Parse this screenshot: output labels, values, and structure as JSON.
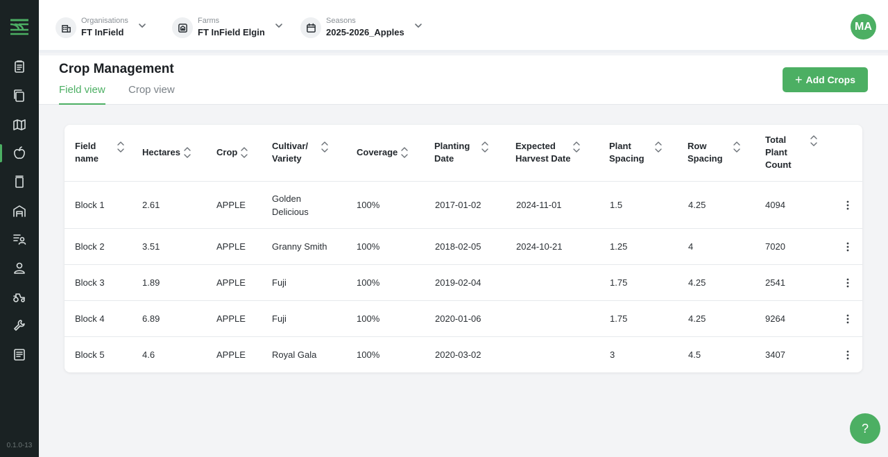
{
  "app": {
    "version": "0.1.0-13",
    "accent_color": "#4caf63",
    "sidebar_color": "#1a2223"
  },
  "sidebar": {
    "items": [
      {
        "icon": "clipboard-icon"
      },
      {
        "icon": "copy-icon"
      },
      {
        "icon": "map-icon"
      },
      {
        "icon": "apple-icon",
        "active": true
      },
      {
        "icon": "archive-icon"
      },
      {
        "icon": "warehouse-icon"
      },
      {
        "icon": "list-user-icon"
      },
      {
        "icon": "user-icon"
      },
      {
        "icon": "tractor-icon"
      },
      {
        "icon": "wrench-icon"
      },
      {
        "icon": "report-icon"
      }
    ]
  },
  "topbar": {
    "organisation": {
      "label": "Organisations",
      "value": "FT InField",
      "icon": "building-icon"
    },
    "farm": {
      "label": "Farms",
      "value": "FT InField Elgin",
      "icon": "farm-icon"
    },
    "season": {
      "label": "Seasons",
      "value": "2025-2026_Apples",
      "icon": "calendar-icon"
    },
    "avatar_initials": "MA"
  },
  "page": {
    "title": "Crop Management",
    "tabs": [
      {
        "label": "Field view",
        "active": true
      },
      {
        "label": "Crop view",
        "active": false
      }
    ],
    "add_button": "Add Crops"
  },
  "table": {
    "headers": [
      {
        "line1": "Field",
        "line2": "name"
      },
      {
        "line1": "Hectares"
      },
      {
        "line1": "Crop"
      },
      {
        "line1": "Cultivar/",
        "line2": "Variety"
      },
      {
        "line1": "Coverage"
      },
      {
        "line1": "Planting",
        "line2": "Date"
      },
      {
        "line1": "Expected",
        "line2": "Harvest Date"
      },
      {
        "line1": "Plant",
        "line2": "Spacing"
      },
      {
        "line1": "Row",
        "line2": "Spacing"
      },
      {
        "line1": "Total",
        "line2": "Plant",
        "line3": "Count"
      }
    ],
    "rows": [
      {
        "field": "Block 1",
        "hectares": "2.61",
        "crop": "APPLE",
        "cultivar": "Golden Delicious",
        "cultivar_l1": "Golden",
        "cultivar_l2": "Delicious",
        "coverage": "100%",
        "planting": "2017-01-02",
        "harvest": "2024-11-01",
        "plant_spacing": "1.5",
        "row_spacing": "4.25",
        "count": "4094"
      },
      {
        "field": "Block 2",
        "hectares": "3.51",
        "crop": "APPLE",
        "cultivar": "Granny Smith",
        "coverage": "100%",
        "planting": "2018-02-05",
        "harvest": "2024-10-21",
        "plant_spacing": "1.25",
        "row_spacing": "4",
        "count": "7020"
      },
      {
        "field": "Block 3",
        "hectares": "1.89",
        "crop": "APPLE",
        "cultivar": "Fuji",
        "coverage": "100%",
        "planting": "2019-02-04",
        "harvest": "",
        "plant_spacing": "1.75",
        "row_spacing": "4.25",
        "count": "2541"
      },
      {
        "field": "Block 4",
        "hectares": "6.89",
        "crop": "APPLE",
        "cultivar": "Fuji",
        "coverage": "100%",
        "planting": "2020-01-06",
        "harvest": "",
        "plant_spacing": "1.75",
        "row_spacing": "4.25",
        "count": "9264"
      },
      {
        "field": "Block 5",
        "hectares": "4.6",
        "crop": "APPLE",
        "cultivar": "Royal Gala",
        "coverage": "100%",
        "planting": "2020-03-02",
        "harvest": "",
        "plant_spacing": "3",
        "row_spacing": "4.5",
        "count": "3407"
      }
    ]
  },
  "help_button": "?"
}
